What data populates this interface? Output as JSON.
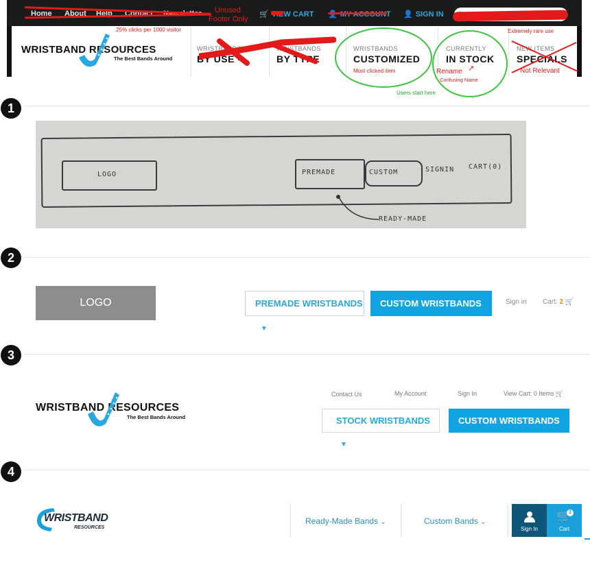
{
  "top_screenshot": {
    "utility_links": [
      "Home",
      "About",
      "Help",
      "Contact",
      "Newsletter"
    ],
    "view_cart": "VIEW CART",
    "my_account": "MY ACCOUNT",
    "sign_in": "SIGN IN",
    "logo_title": "WRISTBAND RESOURCES",
    "logo_tagline": "The Best Bands Around",
    "nav": [
      {
        "small": "WRISTBANDS",
        "big": "BY USE"
      },
      {
        "small": "WRISTBANDS",
        "big": "BY TYPE"
      },
      {
        "small": "WRISTBANDS",
        "big": "CUSTOMIZED"
      },
      {
        "small": "CURRENTLY",
        "big": "IN STOCK"
      },
      {
        "small": "NEW ITEMS",
        "big": "SPECIALS"
      }
    ],
    "annotations": {
      "unused": "Unused",
      "footer_only": "Footer Only",
      "clicks": ".25% clicks per 1000 visitor",
      "extremely_rare": "Extremely rare use",
      "most_clicked": "Most clicked item",
      "rename": "Rename",
      "confusing": "Confusing Name",
      "not_relevant": "Not Relevant",
      "users_start": "Users start here"
    },
    "colors": {
      "accent": "#29a8e0",
      "annotation_red": "#e21a1a",
      "annotation_green": "#22a52b"
    }
  },
  "sections": {
    "one": "1",
    "two": "2",
    "three": "3",
    "four": "4"
  },
  "sketch": {
    "logo": "LOGO",
    "premade": "PREMADE",
    "custom": "CUSTOM",
    "signin": "SIGNIN",
    "cart": "CART(0)",
    "note": "READY-MADE"
  },
  "mockup2": {
    "logo": "LOGO",
    "premade": "PREMADE WRISTBANDS",
    "custom": "CUSTOM WRISTBANDS",
    "signin": "Sign in",
    "cart_label": "Cart:",
    "cart_count": "2"
  },
  "mockup3": {
    "logo_title": "WRISTBAND RESOURCES",
    "logo_tagline": "The Best Bands Around",
    "contact": "Contact Us",
    "account": "My Account",
    "signin": "Sign In",
    "view_cart": "View Cart: 0 Items",
    "stock": "STOCK WRISTBANDS",
    "custom": "CUSTOM WRISTBANDS"
  },
  "mockup4": {
    "logo_title": "WRISTBAND",
    "logo_sub": "RESOURCES",
    "ready_made": "Ready-Made Bands",
    "custom": "Custom Bands",
    "signin": "Sign In",
    "cart": "Cart",
    "cart_count": "3"
  }
}
